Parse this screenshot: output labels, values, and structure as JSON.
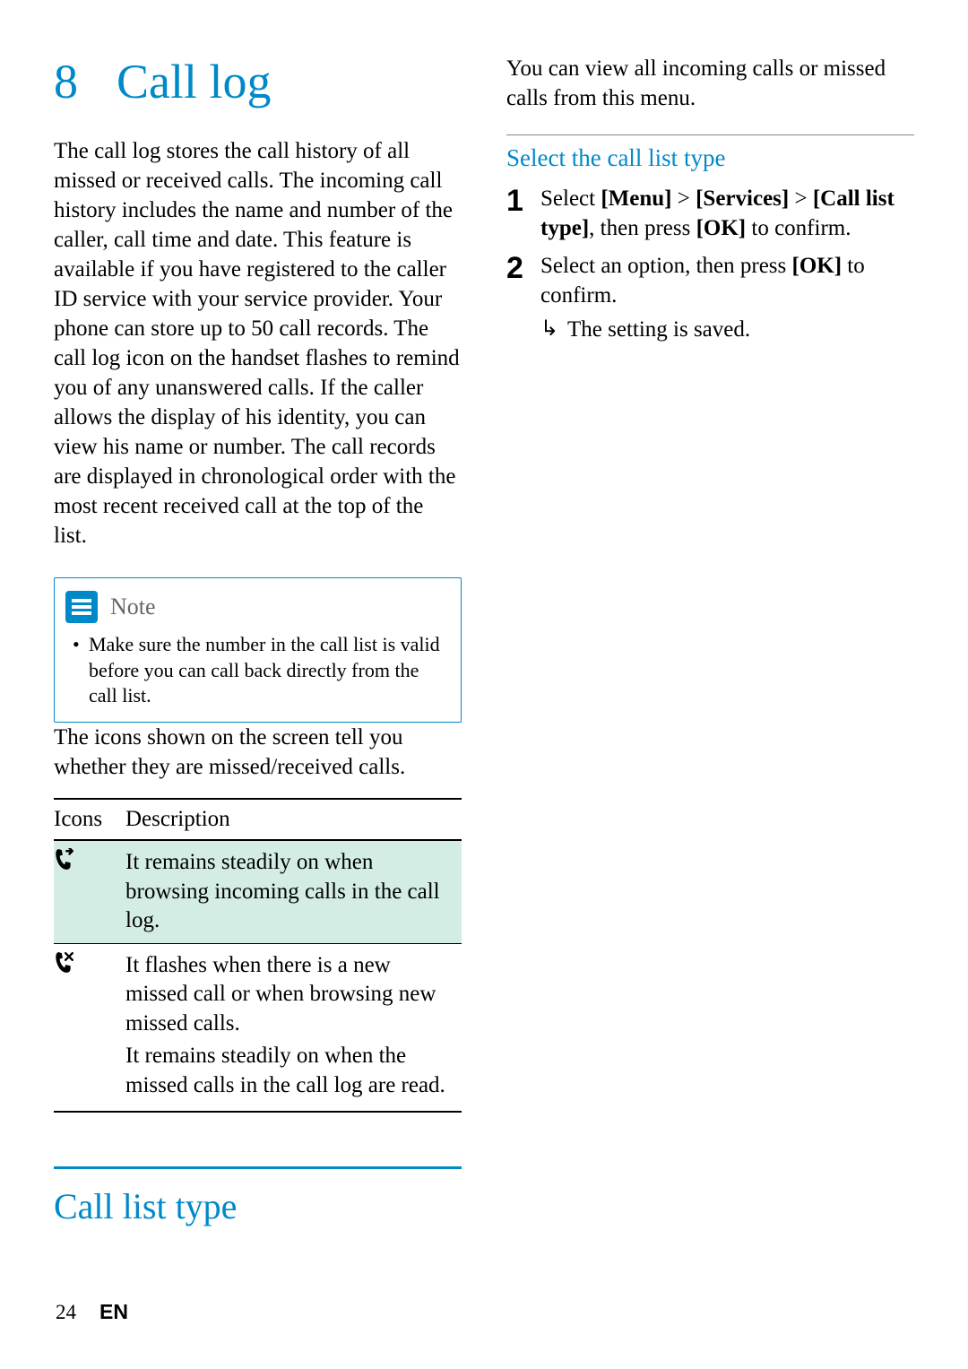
{
  "chapter": {
    "number": "8",
    "title": "Call log"
  },
  "intro": "The call log stores the call history of all missed or received calls. The incoming call history includes the name and number of the caller, call time and date. This feature is available if you have registered to the caller ID service with your service provider. Your phone can store up to 50 call records. The call log icon on the handset flashes to remind you of any unanswered calls. If the caller allows the display of his identity, you can view his name or number. The call records are displayed in chronological order with the most recent received call at the top of the list.",
  "note": {
    "label": "Note",
    "item": "Make sure the number in the call list is valid before you can call back directly from the call list."
  },
  "icons_intro": "The icons shown on the screen tell you whether they are missed/received calls.",
  "table": {
    "h1": "Icons",
    "h2": "Description",
    "r1": "It remains steadily on when browsing incoming calls in the call log.",
    "r2a": "It flashes when there is a new missed call or when browsing new missed calls.",
    "r2b": "It remains steadily on when the missed calls in the call log are read."
  },
  "section2": {
    "heading": "Call list type",
    "intro": "You can view all incoming calls or missed calls from this menu.",
    "sub": "Select the call list type",
    "step1_a": "Select ",
    "step1_b": "[Menu]",
    "step1_c": " > ",
    "step1_d": "[Services]",
    "step1_e": " > ",
    "step1_f": "[Call list type]",
    "step1_g": ", then press ",
    "step1_h": "[OK]",
    "step1_i": " to confirm.",
    "step2_a": "Select an option, then press ",
    "step2_b": "[OK]",
    "step2_c": " to confirm.",
    "result": "The setting is saved."
  },
  "footer": {
    "page": "24",
    "lang": "EN"
  }
}
